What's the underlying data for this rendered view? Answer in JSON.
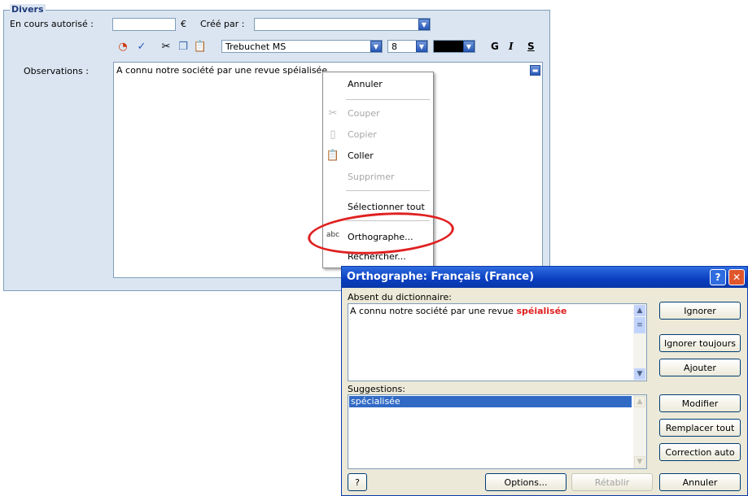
{
  "divers": {
    "legend": "Divers",
    "en_cours_label": "En cours autorisé :",
    "en_cours_value": "",
    "currency": "€",
    "cree_par_label": "Créé par :",
    "cree_par_value": "",
    "font_name": "Trebuchet MS",
    "font_size": "8",
    "bold_label": "G",
    "italic_label": "I",
    "underline_label": "S",
    "observations_label": "Observations :",
    "observations_text": "A connu notre société par une revue spéialisée"
  },
  "context_menu": {
    "items": [
      {
        "label": "Annuler",
        "enabled": true
      },
      {
        "label": "Couper",
        "enabled": false,
        "icon": "scissors-icon"
      },
      {
        "label": "Copier",
        "enabled": false,
        "icon": "copy-icon"
      },
      {
        "label": "Coller",
        "enabled": true,
        "icon": "paste-icon"
      },
      {
        "label": "Supprimer",
        "enabled": false
      },
      {
        "label": "Sélectionner tout",
        "enabled": true
      },
      {
        "label": "Orthographe...",
        "enabled": true,
        "icon": "spellcheck-icon"
      },
      {
        "label": "Rechercher...",
        "enabled": true
      }
    ],
    "highlight_color": "#e02020"
  },
  "spell_dialog": {
    "title": "Orthographe: Français (France)",
    "absent_label": "Absent du dictionnaire:",
    "sentence_prefix": "A connu notre société par une revue ",
    "misspelled_word": "spéialisée",
    "misspelled_color": "#e02020",
    "suggestions_label": "Suggestions:",
    "suggestions": [
      "spécialisée"
    ],
    "buttons": {
      "ignorer": "Ignorer",
      "ignorer_toujours": "Ignorer toujours",
      "ajouter": "Ajouter",
      "modifier": "Modifier",
      "remplacer_tout": "Remplacer tout",
      "correction_auto": "Correction auto",
      "options": "Options...",
      "retablir": "Rétablir",
      "annuler": "Annuler"
    }
  }
}
